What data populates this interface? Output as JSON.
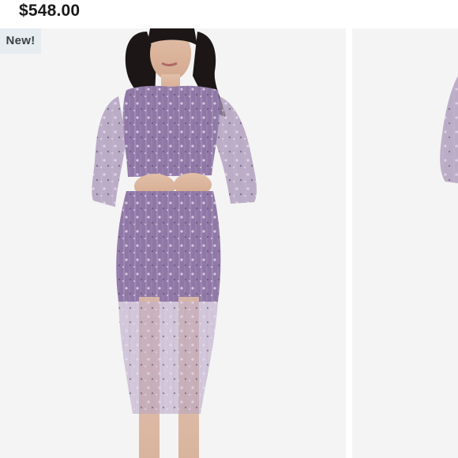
{
  "product": {
    "price": "$548.00",
    "badge": "New!"
  },
  "gallery": {
    "main_image": "sequin-midi-dress-photo",
    "next_image": "sequin-midi-dress-photo-partial",
    "colors": {
      "dress": "#8f78a6",
      "background": "#f4f4f4",
      "badge_bg": "#e6ecef"
    }
  }
}
